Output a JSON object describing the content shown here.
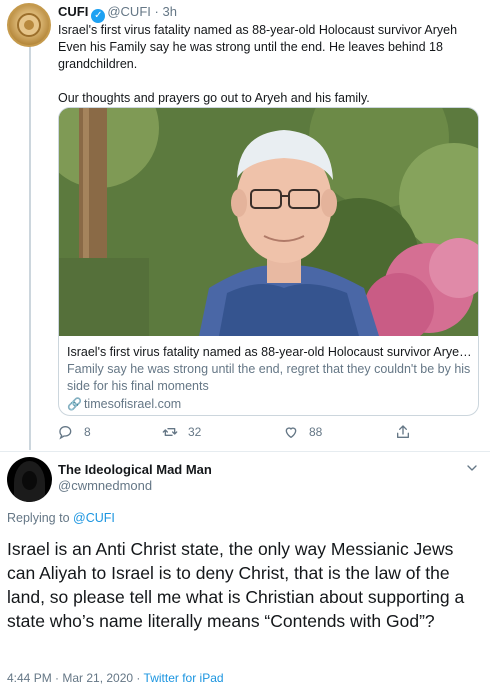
{
  "quoted_tweet": {
    "author_name": "CUFI",
    "author_handle": "@CUFI",
    "separator": "·",
    "time": "3h",
    "text_line1": "Israel's first virus fatality named as 88-year-old Holocaust survivor Aryeh Even his Family say he was strong until the end. He leaves behind 18 grandchildren.",
    "text_line2": "Our thoughts and prayers go out to Aryeh and his family.",
    "card": {
      "title": "Israel's first virus fatality named as 88-year-old Holocaust survivor Aryeh...",
      "description": "Family say he was strong until the end, regret that they couldn't be by his side for his final moments",
      "domain": "timesofisrael.com"
    },
    "actions": {
      "replies": "8",
      "retweets": "32",
      "likes": "88"
    }
  },
  "reply_tweet": {
    "author_name": "The Ideological Mad Man",
    "author_handle": "@cwmnedmond",
    "replying_prefix": "Replying to",
    "replying_to": "@CUFI",
    "text": "Israel is an Anti Christ state, the only way Messianic Jews can Aliyah to Israel is to deny Christ, that is the law of the land, so please tell me what is Christian about supporting a state who’s name literally means “Contends with God”?",
    "timestamp": "4:44 PM · Mar 21, 2020",
    "meta_separator": "·",
    "source": "Twitter for iPad"
  },
  "colors": {
    "accent": "#1da1f2",
    "link": "#1b95e0",
    "secondary_text": "#657786",
    "border": "#ccd6dd"
  },
  "icons": [
    "verified-badge-icon",
    "link-icon",
    "reply-icon",
    "retweet-icon",
    "like-icon",
    "share-icon",
    "chevron-down-icon"
  ]
}
